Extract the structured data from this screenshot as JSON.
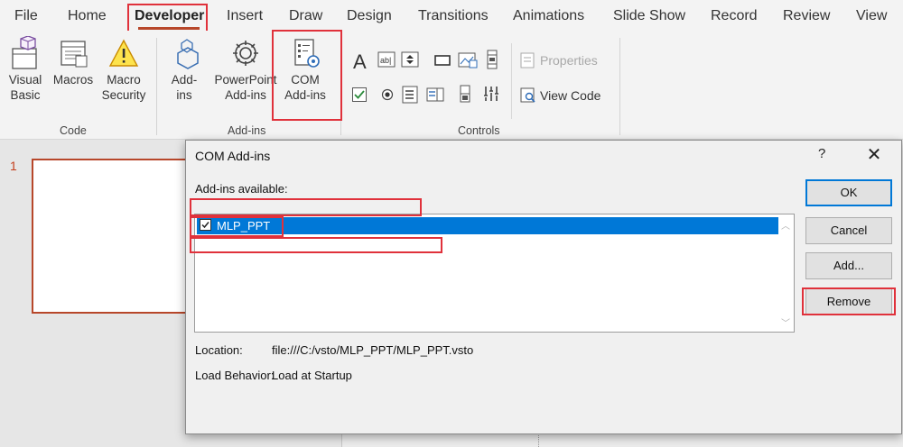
{
  "tabs": [
    {
      "label": "File"
    },
    {
      "label": "Home"
    },
    {
      "label": "Developer",
      "active": true
    },
    {
      "label": "Insert"
    },
    {
      "label": "Draw"
    },
    {
      "label": "Design"
    },
    {
      "label": "Transitions"
    },
    {
      "label": "Animations"
    },
    {
      "label": "Slide Show"
    },
    {
      "label": "Record"
    },
    {
      "label": "Review"
    },
    {
      "label": "View"
    }
  ],
  "ribbon": {
    "code": {
      "label": "Code",
      "visual_basic": [
        "Visual",
        "Basic"
      ],
      "macros": "Macros",
      "macro_security": [
        "Macro",
        "Security"
      ]
    },
    "addins": {
      "label": "Add-ins",
      "addins": [
        "Add-",
        "ins"
      ],
      "powerpoint_addins": [
        "PowerPoint",
        "Add-ins"
      ],
      "com_addins": [
        "COM",
        "Add-ins"
      ]
    },
    "controls": {
      "label": "Controls",
      "properties": "Properties",
      "view_code": "View Code"
    }
  },
  "slide_panel": {
    "slide_number": "1"
  },
  "dialog": {
    "title": "COM Add-ins",
    "help": "?",
    "close": "✕",
    "list_label": "Add-ins available:",
    "items": [
      {
        "label": "MLP_PPT",
        "checked": true,
        "selected": true
      }
    ],
    "buttons": {
      "ok": "OK",
      "cancel": "Cancel",
      "add": "Add...",
      "remove": "Remove"
    },
    "location_label": "Location:",
    "location_value": "file:///C:/vsto/MLP_PPT/MLP_PPT.vsto",
    "load_behavior_label": "Load Behavior:",
    "load_behavior_value": "Load at Startup"
  },
  "colors": {
    "accent": "#b7472a",
    "highlight": "#e0313b",
    "selection": "#0078d7"
  }
}
